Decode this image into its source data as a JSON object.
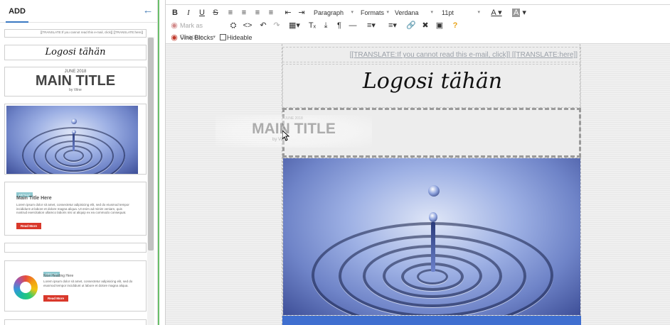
{
  "left_panel": {
    "tab_add": "ADD",
    "cards": {
      "preheader_text": "[[TRANSLATE:If you cannot read this e-mail, click]] [[TRANSLATE:here]]",
      "logo_text": "Logosi tähän",
      "title_date": "JUNE 2018",
      "title_text": "MAIN TITLE",
      "title_by": "by Vilne",
      "article1": {
        "badge": "ARTICLE",
        "heading": "Main Title Here",
        "body": "Lorem ipsum dolor sit amet, consectetur adipisicing elit, sed do eiusmod tempor incididunt ut labore et dolore magna aliqua. Ut enim ad minim veniam, quis nostrud exercitation ullamco laboris nisi ut aliquip ex ea commodo consequat.",
        "button": "Read More"
      },
      "article2": {
        "badge": "ARTICLE",
        "heading": "Nice Heading Here",
        "body": "Lorem ipsum dolor sit amet, consectetur adipisicing elit, sed do eiusmod tempor incididunt ut labore et dolore magna aliqua.",
        "button": "Read More"
      }
    }
  },
  "toolbar": {
    "paragraph": "Paragraph",
    "formats": "Formats",
    "font": "Verdana",
    "size": "11pt",
    "mark_as_chapter": "Mark as Chapter",
    "vine_blocks": "Vine Blocks",
    "hideable": "Hideable"
  },
  "email": {
    "preheader": "[[TRANSLATE:If you cannot read this e-mail, click]] [[TRANSLATE:here]]",
    "logo": "Logosi tähän",
    "ghost_date": "JUNE 2018",
    "ghost_title": "MAIN TITLE",
    "ghost_by": "by Vilne"
  },
  "colors": {
    "accent": "#3a78c2",
    "divider": "#6abf6a",
    "read_more": "#d9382b",
    "blue_strip": "#3f6fd0"
  }
}
